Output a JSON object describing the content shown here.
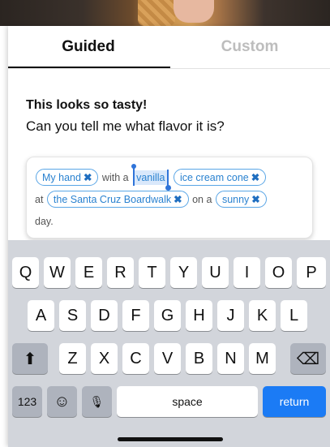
{
  "tabs": {
    "guided": "Guided",
    "custom": "Custom"
  },
  "prompt": {
    "title": "This looks so tasty!",
    "question": "Can you tell me what flavor it is?"
  },
  "sentence": {
    "chip_1": "My hand",
    "with_a": "with a",
    "selected": "vanilla",
    "chip_2": "ice cream cone",
    "at": "at",
    "chip_3": "the Santa Cruz Boardwalk",
    "on_a": "on a",
    "chip_4": "sunny",
    "end": "day.",
    "remove_glyph": "✖"
  },
  "keyboard": {
    "row1": [
      "Q",
      "W",
      "E",
      "R",
      "T",
      "Y",
      "U",
      "I",
      "O",
      "P"
    ],
    "row2": [
      "A",
      "S",
      "D",
      "F",
      "G",
      "H",
      "J",
      "K",
      "L"
    ],
    "row3": [
      "Z",
      "X",
      "C",
      "V",
      "B",
      "N",
      "M"
    ],
    "shift": "⬆",
    "backspace": "⌫",
    "numbers": "123",
    "emoji": "☺",
    "mic": "🎙",
    "space": "space",
    "return": "return"
  },
  "colors": {
    "accent": "#1b7bf5",
    "chip_border": "#5aa6e6",
    "selection": "#d9e8fb",
    "keyboard_bg": "#d2d5db"
  }
}
